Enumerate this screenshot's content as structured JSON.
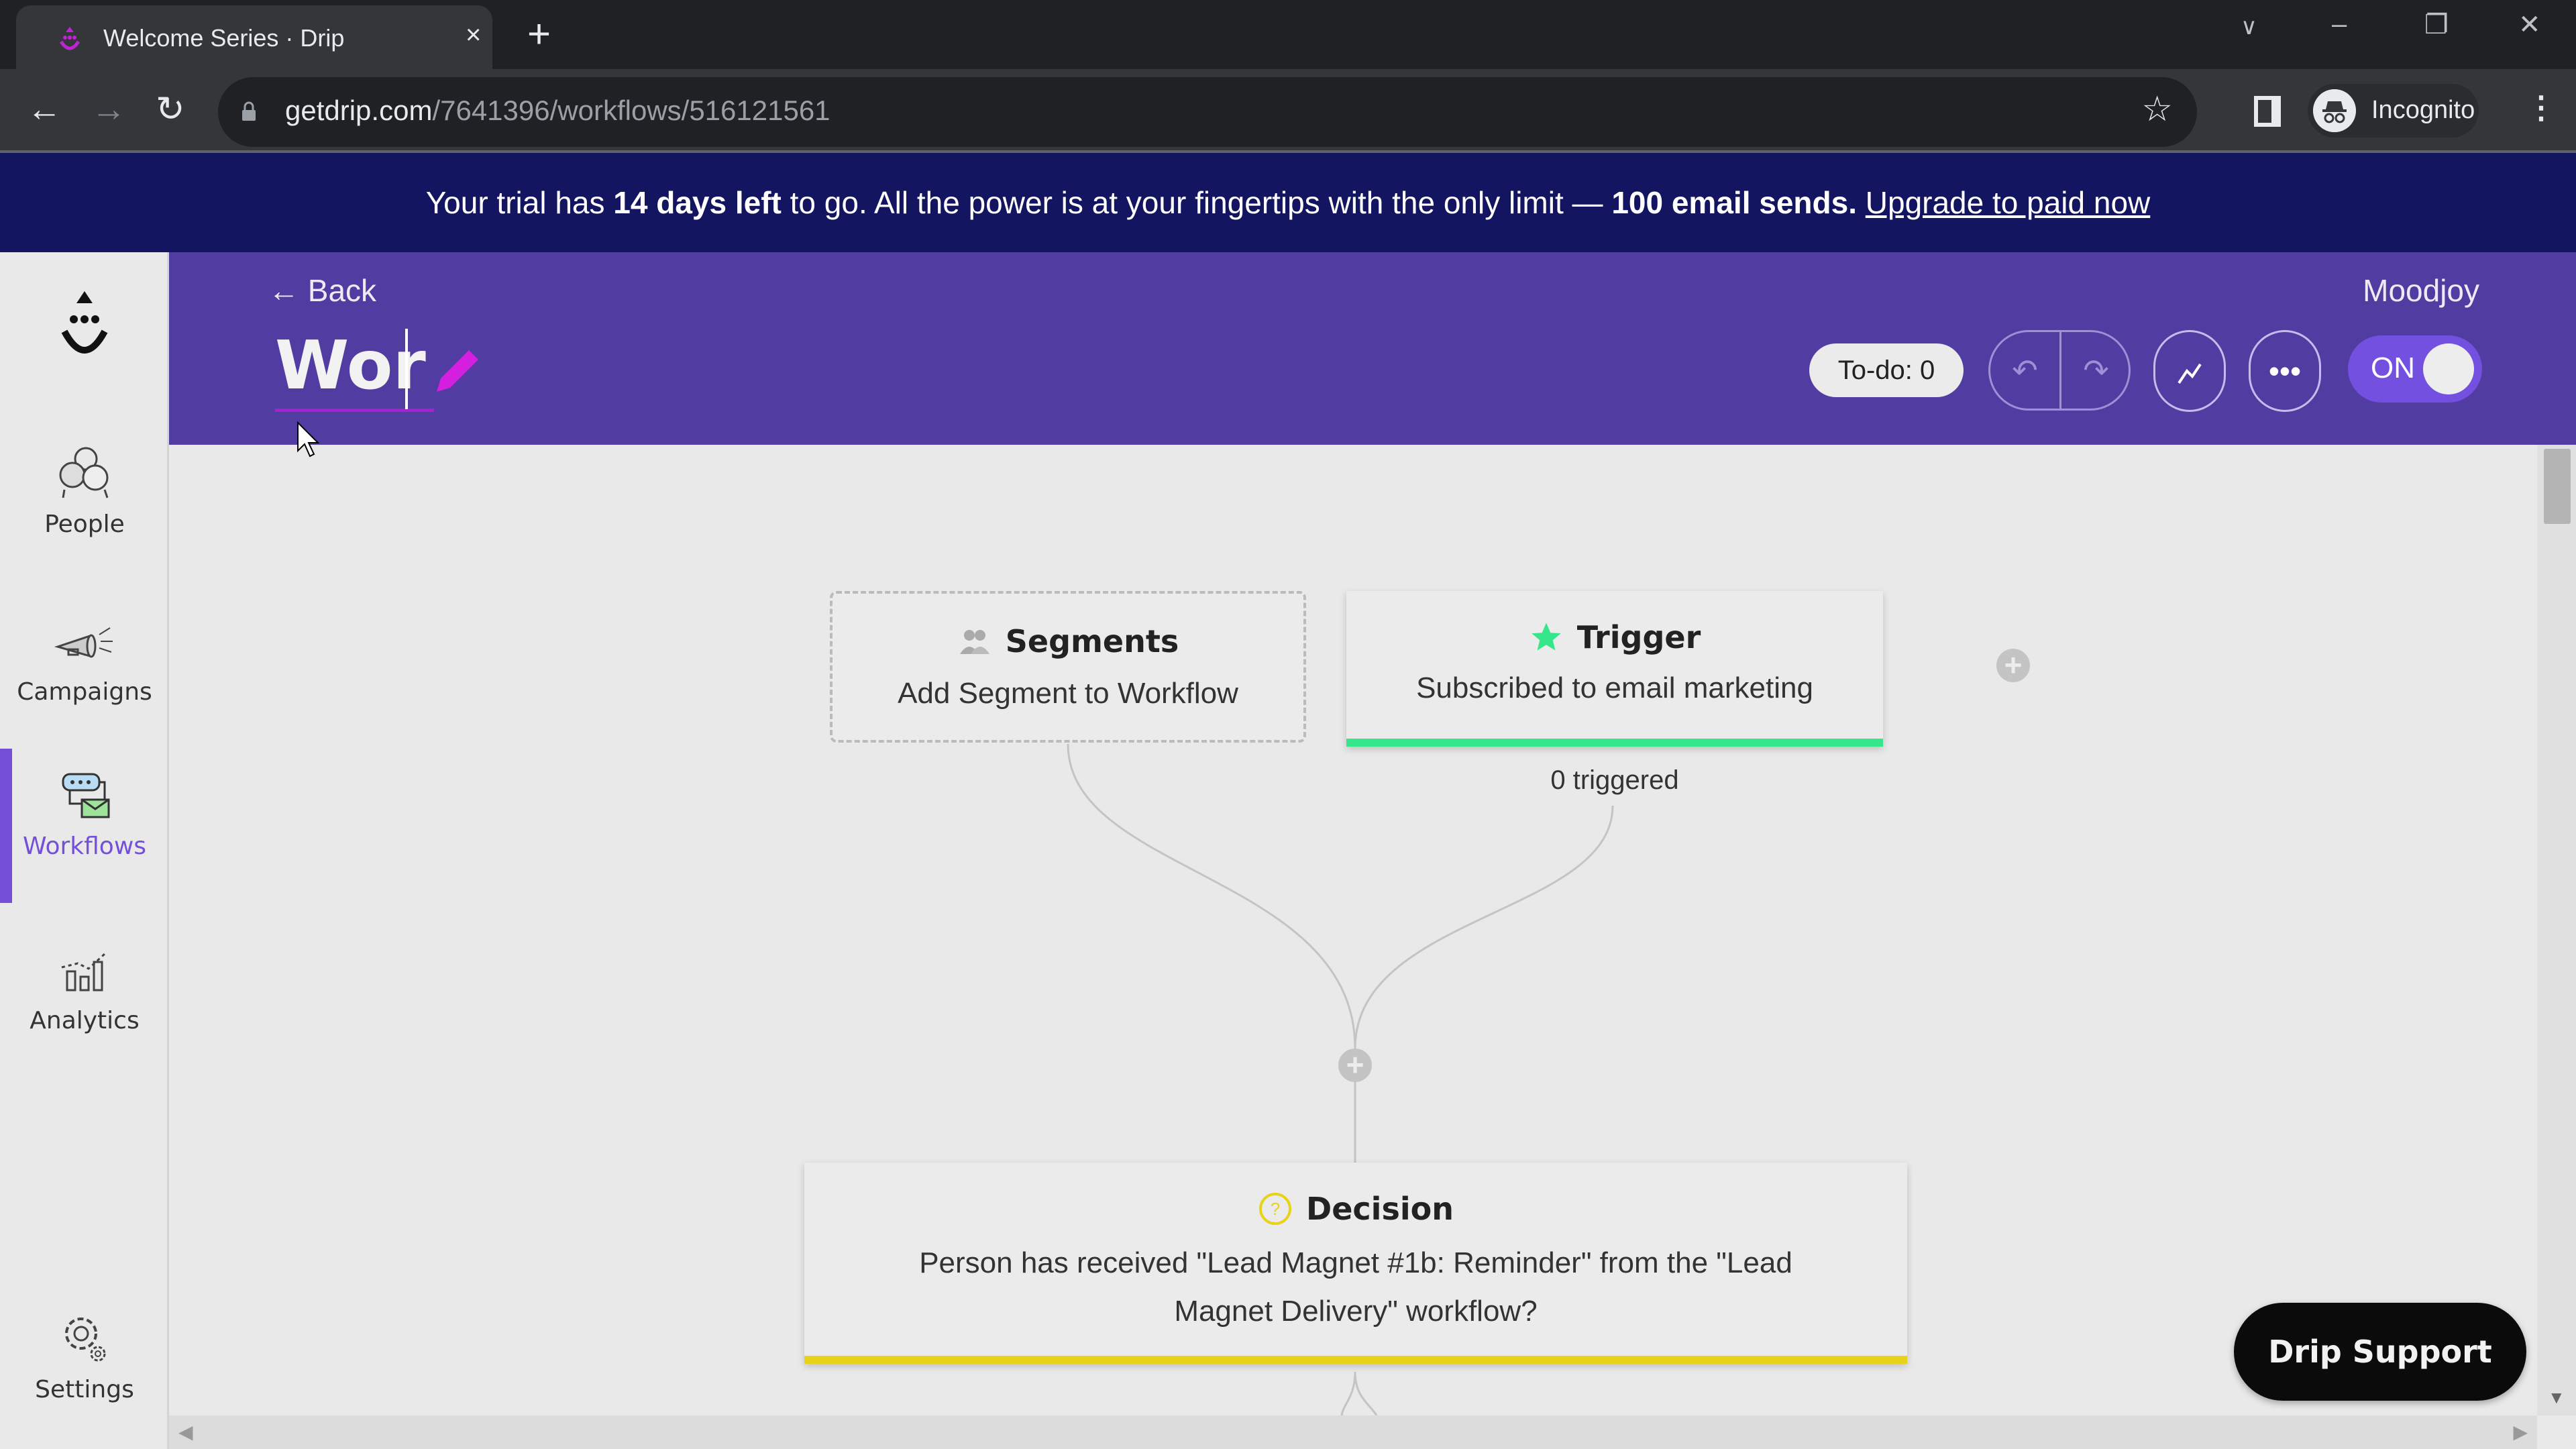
{
  "browser": {
    "tab_title": "Welcome Series · Drip",
    "url_domain": "getdrip.com",
    "url_path": "/7641396/workflows/516121561",
    "profile_label": "Incognito"
  },
  "banner": {
    "text_1": "Your trial has ",
    "bold_1": "14 days left",
    "text_2": " to go. All the power is at your fingertips with the only limit — ",
    "bold_2": "100 email sends.",
    "link": "Upgrade to paid now"
  },
  "sidebar": {
    "items": [
      {
        "label": "People",
        "icon": "people-icon",
        "active": false
      },
      {
        "label": "Campaigns",
        "icon": "megaphone-icon",
        "active": false
      },
      {
        "label": "Workflows",
        "icon": "workflow-icon",
        "active": true
      },
      {
        "label": "Analytics",
        "icon": "analytics-icon",
        "active": false
      },
      {
        "label": "Settings",
        "icon": "gear-icon",
        "active": false
      }
    ]
  },
  "header": {
    "back_label": "Back",
    "workflow_name": "Wor",
    "account_name": "Moodjoy",
    "todo_label": "To-do: 0",
    "toggle_label": "ON",
    "toggle_on": true,
    "colors": {
      "header_bg": "#513ca1",
      "accent": "#7450d9",
      "pencil": "#d41ee0"
    }
  },
  "canvas": {
    "segments": {
      "title": "Segments",
      "subtitle": "Add Segment to Workflow"
    },
    "trigger": {
      "title": "Trigger",
      "subtitle": "Subscribed to email marketing",
      "count_label": "0 triggered",
      "color": "#35e68a"
    },
    "decision": {
      "title": "Decision",
      "text": "Person has received \"Lead Magnet #1b: Reminder\" from the \"Lead Magnet Delivery\" workflow?",
      "color": "#e8d318"
    }
  },
  "support": {
    "label": "Drip Support"
  }
}
